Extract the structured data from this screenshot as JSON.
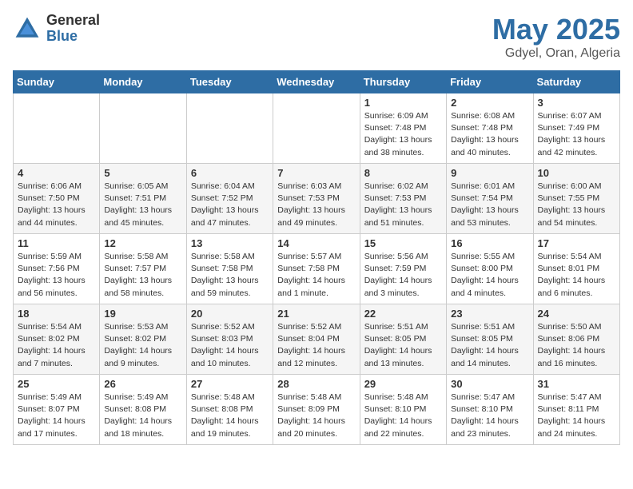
{
  "header": {
    "logo_general": "General",
    "logo_blue": "Blue",
    "title": "May 2025",
    "location": "Gdyel, Oran, Algeria"
  },
  "days_of_week": [
    "Sunday",
    "Monday",
    "Tuesday",
    "Wednesday",
    "Thursday",
    "Friday",
    "Saturday"
  ],
  "weeks": [
    [
      {
        "day": "",
        "info": ""
      },
      {
        "day": "",
        "info": ""
      },
      {
        "day": "",
        "info": ""
      },
      {
        "day": "",
        "info": ""
      },
      {
        "day": "1",
        "info": "Sunrise: 6:09 AM\nSunset: 7:48 PM\nDaylight: 13 hours\nand 38 minutes."
      },
      {
        "day": "2",
        "info": "Sunrise: 6:08 AM\nSunset: 7:48 PM\nDaylight: 13 hours\nand 40 minutes."
      },
      {
        "day": "3",
        "info": "Sunrise: 6:07 AM\nSunset: 7:49 PM\nDaylight: 13 hours\nand 42 minutes."
      }
    ],
    [
      {
        "day": "4",
        "info": "Sunrise: 6:06 AM\nSunset: 7:50 PM\nDaylight: 13 hours\nand 44 minutes."
      },
      {
        "day": "5",
        "info": "Sunrise: 6:05 AM\nSunset: 7:51 PM\nDaylight: 13 hours\nand 45 minutes."
      },
      {
        "day": "6",
        "info": "Sunrise: 6:04 AM\nSunset: 7:52 PM\nDaylight: 13 hours\nand 47 minutes."
      },
      {
        "day": "7",
        "info": "Sunrise: 6:03 AM\nSunset: 7:53 PM\nDaylight: 13 hours\nand 49 minutes."
      },
      {
        "day": "8",
        "info": "Sunrise: 6:02 AM\nSunset: 7:53 PM\nDaylight: 13 hours\nand 51 minutes."
      },
      {
        "day": "9",
        "info": "Sunrise: 6:01 AM\nSunset: 7:54 PM\nDaylight: 13 hours\nand 53 minutes."
      },
      {
        "day": "10",
        "info": "Sunrise: 6:00 AM\nSunset: 7:55 PM\nDaylight: 13 hours\nand 54 minutes."
      }
    ],
    [
      {
        "day": "11",
        "info": "Sunrise: 5:59 AM\nSunset: 7:56 PM\nDaylight: 13 hours\nand 56 minutes."
      },
      {
        "day": "12",
        "info": "Sunrise: 5:58 AM\nSunset: 7:57 PM\nDaylight: 13 hours\nand 58 minutes."
      },
      {
        "day": "13",
        "info": "Sunrise: 5:58 AM\nSunset: 7:58 PM\nDaylight: 13 hours\nand 59 minutes."
      },
      {
        "day": "14",
        "info": "Sunrise: 5:57 AM\nSunset: 7:58 PM\nDaylight: 14 hours\nand 1 minute."
      },
      {
        "day": "15",
        "info": "Sunrise: 5:56 AM\nSunset: 7:59 PM\nDaylight: 14 hours\nand 3 minutes."
      },
      {
        "day": "16",
        "info": "Sunrise: 5:55 AM\nSunset: 8:00 PM\nDaylight: 14 hours\nand 4 minutes."
      },
      {
        "day": "17",
        "info": "Sunrise: 5:54 AM\nSunset: 8:01 PM\nDaylight: 14 hours\nand 6 minutes."
      }
    ],
    [
      {
        "day": "18",
        "info": "Sunrise: 5:54 AM\nSunset: 8:02 PM\nDaylight: 14 hours\nand 7 minutes."
      },
      {
        "day": "19",
        "info": "Sunrise: 5:53 AM\nSunset: 8:02 PM\nDaylight: 14 hours\nand 9 minutes."
      },
      {
        "day": "20",
        "info": "Sunrise: 5:52 AM\nSunset: 8:03 PM\nDaylight: 14 hours\nand 10 minutes."
      },
      {
        "day": "21",
        "info": "Sunrise: 5:52 AM\nSunset: 8:04 PM\nDaylight: 14 hours\nand 12 minutes."
      },
      {
        "day": "22",
        "info": "Sunrise: 5:51 AM\nSunset: 8:05 PM\nDaylight: 14 hours\nand 13 minutes."
      },
      {
        "day": "23",
        "info": "Sunrise: 5:51 AM\nSunset: 8:05 PM\nDaylight: 14 hours\nand 14 minutes."
      },
      {
        "day": "24",
        "info": "Sunrise: 5:50 AM\nSunset: 8:06 PM\nDaylight: 14 hours\nand 16 minutes."
      }
    ],
    [
      {
        "day": "25",
        "info": "Sunrise: 5:49 AM\nSunset: 8:07 PM\nDaylight: 14 hours\nand 17 minutes."
      },
      {
        "day": "26",
        "info": "Sunrise: 5:49 AM\nSunset: 8:08 PM\nDaylight: 14 hours\nand 18 minutes."
      },
      {
        "day": "27",
        "info": "Sunrise: 5:48 AM\nSunset: 8:08 PM\nDaylight: 14 hours\nand 19 minutes."
      },
      {
        "day": "28",
        "info": "Sunrise: 5:48 AM\nSunset: 8:09 PM\nDaylight: 14 hours\nand 20 minutes."
      },
      {
        "day": "29",
        "info": "Sunrise: 5:48 AM\nSunset: 8:10 PM\nDaylight: 14 hours\nand 22 minutes."
      },
      {
        "day": "30",
        "info": "Sunrise: 5:47 AM\nSunset: 8:10 PM\nDaylight: 14 hours\nand 23 minutes."
      },
      {
        "day": "31",
        "info": "Sunrise: 5:47 AM\nSunset: 8:11 PM\nDaylight: 14 hours\nand 24 minutes."
      }
    ]
  ]
}
